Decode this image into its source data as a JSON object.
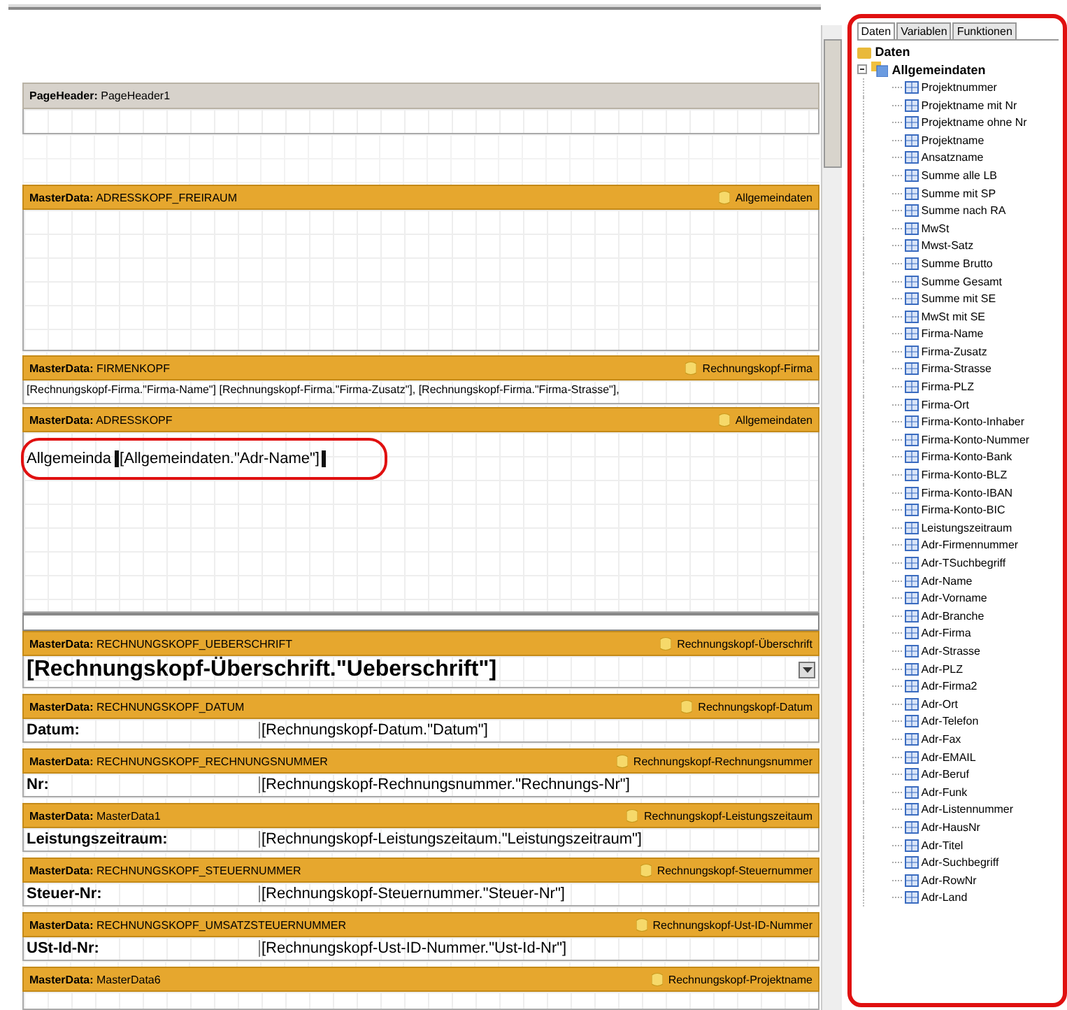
{
  "designer": {
    "bands": [
      {
        "kind": "page_header",
        "title": "**PageHeader:** PageHeader1"
      },
      {
        "kind": "master_data",
        "title": "**MasterData:** ADRESSKOPF_FREIRAUM",
        "source": "Allgemeindaten"
      },
      {
        "kind": "master_data",
        "title": "**MasterData:** FIRMENKOPF",
        "source": "Rechnungskopf-Firma",
        "text": "[Rechnungskopf-Firma.\"Firma-Name\"] [Rechnungskopf-Firma.\"Firma-Zusatz\"], [Rechnungskopf-Firma.\"Firma-Strasse\"],"
      },
      {
        "kind": "master_data",
        "title": "**MasterData:** ADRESSKOPF",
        "source": "Allgemeindaten",
        "fields": [
          {
            "label": "Allgemeinda",
            "value": "[Allgemeindaten.\"Adr-Name\"]",
            "selected": true
          }
        ]
      },
      {
        "kind": "master_data",
        "title": "**MasterData:** RECHNUNGSKOPF_UEBERSCHRIFT",
        "source": "Rechnungskopf-Überschrift",
        "heading": "[Rechnungskopf-Überschrift.\"Ueberschrift\"]"
      },
      {
        "kind": "master_data",
        "title": "**MasterData:** RECHNUNGSKOPF_DATUM",
        "source": "Rechnungskopf-Datum",
        "fields": [
          {
            "label": "Datum:",
            "value": "[Rechnungskopf-Datum.\"Datum\"]",
            "selected": false
          }
        ]
      },
      {
        "kind": "master_data",
        "title": "**MasterData:** RECHNUNGSKOPF_RECHNUNGSNUMMER",
        "source": "Rechnungskopf-Rechnungsnummer",
        "fields": [
          {
            "label": "Nr:",
            "value": "[Rechnungskopf-Rechnungsnummer.\"Rechnungs-Nr\"]",
            "selected": false
          }
        ]
      },
      {
        "kind": "master_data",
        "title": "**MasterData:** MasterData1",
        "source": "Rechnungskopf-Leistungszeitaum",
        "fields": [
          {
            "label": "Leistungszeitraum:",
            "value": "[Rechnungskopf-Leistungszeitaum.\"Leistungszeitraum\"]",
            "selected": false
          }
        ]
      },
      {
        "kind": "master_data",
        "title": "**MasterData:** RECHNUNGSKOPF_STEUERNUMMER",
        "source": "Rechnungskopf-Steuernummer",
        "fields": [
          {
            "label": "Steuer-Nr:",
            "value": "[Rechnungskopf-Steuernummer.\"Steuer-Nr\"]",
            "selected": false
          }
        ]
      },
      {
        "kind": "master_data",
        "title": "**MasterData:** RECHNUNGSKOPF_UMSATZSTEUERNUMMER",
        "source": "Rechnungskopf-Ust-ID-Nummer",
        "fields": [
          {
            "label": "USt-Id-Nr:",
            "value": "[Rechnungskopf-Ust-ID-Nummer.\"Ust-Id-Nr\"]",
            "selected": false
          }
        ]
      },
      {
        "kind": "master_data",
        "title": "**MasterData:** MasterData6",
        "source": "Rechnungskopf-Projektname"
      }
    ]
  },
  "data_panel": {
    "tabs": [
      {
        "label": "Daten",
        "selected": true
      },
      {
        "label": "Variablen",
        "selected": false
      },
      {
        "label": "Funktionen",
        "selected": false
      }
    ],
    "tree": [
      {
        "label": "Daten",
        "children": [
          {
            "label": "Allgemeindaten",
            "expanded": true,
            "children": [
              {
                "label": "Projektnummer"
              },
              {
                "label": "Projektname mit Nr"
              },
              {
                "label": "Projektname ohne Nr"
              },
              {
                "label": "Projektname"
              },
              {
                "label": "Ansatzname"
              },
              {
                "label": "Summe alle LB"
              },
              {
                "label": "Summe mit SP"
              },
              {
                "label": "Summe nach RA"
              },
              {
                "label": "MwSt"
              },
              {
                "label": "Mwst-Satz"
              },
              {
                "label": "Summe Brutto"
              },
              {
                "label": "Summe Gesamt"
              },
              {
                "label": "Summe mit SE"
              },
              {
                "label": "MwSt mit SE"
              },
              {
                "label": "Firma-Name"
              },
              {
                "label": "Firma-Zusatz"
              },
              {
                "label": "Firma-Strasse"
              },
              {
                "label": "Firma-PLZ"
              },
              {
                "label": "Firma-Ort"
              },
              {
                "label": "Firma-Konto-Inhaber"
              },
              {
                "label": "Firma-Konto-Nummer"
              },
              {
                "label": "Firma-Konto-Bank"
              },
              {
                "label": "Firma-Konto-BLZ"
              },
              {
                "label": "Firma-Konto-IBAN"
              },
              {
                "label": "Firma-Konto-BIC"
              },
              {
                "label": "Leistungszeitraum"
              },
              {
                "label": "Adr-Firmennummer"
              },
              {
                "label": "Adr-TSuchbegriff"
              },
              {
                "label": "Adr-Name"
              },
              {
                "label": "Adr-Vorname"
              },
              {
                "label": "Adr-Branche"
              },
              {
                "label": "Adr-Firma"
              },
              {
                "label": "Adr-Strasse"
              },
              {
                "label": "Adr-PLZ"
              },
              {
                "label": "Adr-Firma2"
              },
              {
                "label": "Adr-Ort"
              },
              {
                "label": "Adr-Telefon"
              },
              {
                "label": "Adr-Fax"
              },
              {
                "label": "Adr-EMAIL"
              },
              {
                "label": "Adr-Beruf"
              },
              {
                "label": "Adr-Funk"
              },
              {
                "label": "Adr-Listennummer"
              },
              {
                "label": "Adr-HausNr"
              },
              {
                "label": "Adr-Titel"
              },
              {
                "label": "Adr-Suchbegriff"
              },
              {
                "label": "Adr-RowNr"
              },
              {
                "label": "Adr-Land"
              }
            ]
          }
        ]
      }
    ]
  }
}
